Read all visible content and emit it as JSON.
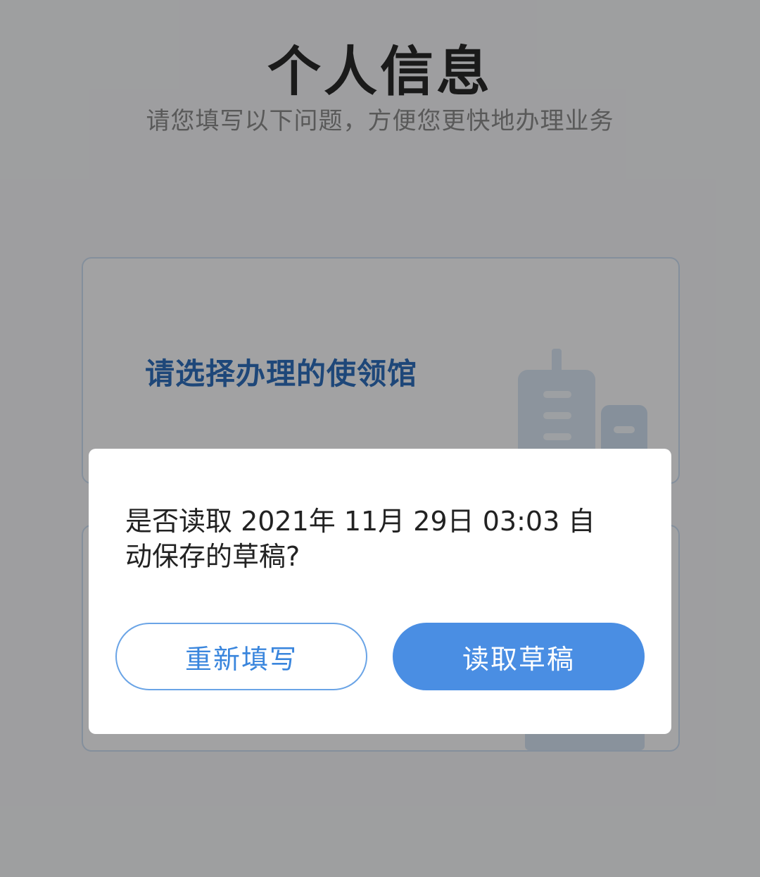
{
  "page": {
    "title": "个人信息",
    "subtitle": "请您填写以下问题，方便您更快地办理业务"
  },
  "cards": [
    {
      "label": "请选择办理的使领馆",
      "icon": "building-icon"
    },
    {
      "label": "",
      "icon": "building-icon"
    }
  ],
  "dialog": {
    "message": "是否读取 2021年 11月 29日  03:03 自动保存的草稿?",
    "cancel_label": "重新填写",
    "confirm_label": "读取草稿"
  },
  "colors": {
    "accent": "#4a8ee3",
    "card_text": "#2f6fbe",
    "overlay": "rgba(0,0,0,0.36)"
  }
}
